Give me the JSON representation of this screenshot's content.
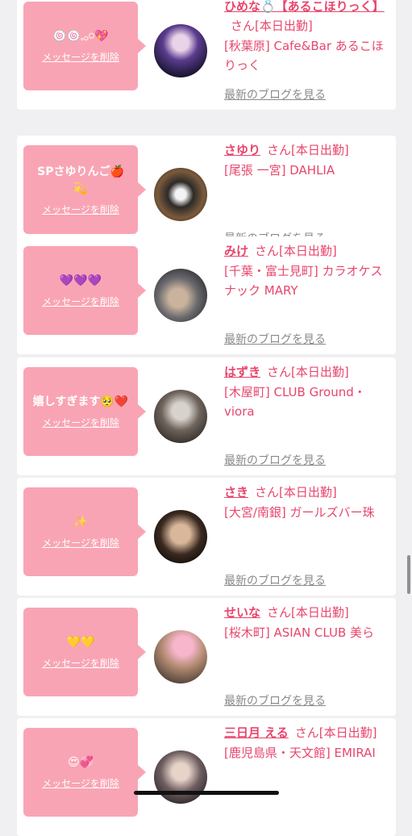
{
  "common": {
    "delete_label": "メッセージを削除",
    "blog_label": "最新のブログを見る",
    "suffix": "さん[本日出勤]"
  },
  "cards": [
    {
      "message": "🍥🍥𓈒𓂂𓏸💖",
      "name": "ひめな💍【あるこほりっく】",
      "shop": "[秋葉原] Cafe&Bar あるこほりっく"
    },
    {
      "message": "SPさゆりんご🍎💫",
      "name": "さゆり",
      "shop": "[尾張 一宮] DAHLIA"
    },
    {
      "message": "💜💜💜",
      "name": "みけ",
      "shop": "[千葉・富士見町] カラオケスナック MARY"
    },
    {
      "message": "嬉しすぎます🥺❤️",
      "name": "はずき",
      "shop": "[木屋町] CLUB Ground・viora"
    },
    {
      "message": "✨",
      "name": "さき",
      "shop": "[大宮/南銀] ガールズバー珠"
    },
    {
      "message": "💛💛",
      "name": "せいな",
      "shop": "[桜木町] ASIAN CLUB 美ら"
    },
    {
      "message": "😍💞",
      "name": "三日月 える",
      "shop": "[鹿児島県・天文館] EMIRAI"
    }
  ],
  "colors": {
    "accent": "#e8466c",
    "bubble": "#f9a4b4",
    "background": "#f0f0f2",
    "link_gray": "#8a8a8a"
  }
}
